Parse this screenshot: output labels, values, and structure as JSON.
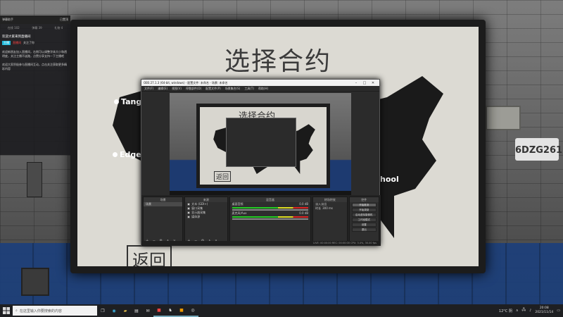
{
  "overlay": {
    "header_left": "弹幕助手",
    "header_right": "已置顶",
    "stats": [
      "在线 102",
      "弹幕 39",
      "礼物 4"
    ],
    "title": "欢迎大家来到直播间",
    "tag1": "主播",
    "tag2": "直播间",
    "tag3": "关注了你",
    "para1": "欢迎新朋友加入直播间，右侧可以调整字体大小和透明度，关注主播不迷路，点赞分享支持一下主播吧",
    "para2": "欢迎大家积极参与直播间互动，点击关注获取更多精彩内容"
  },
  "scene": {
    "board_title": "选择合约",
    "city_left_top": "Tang",
    "city_left_mid": "Edgefie",
    "city_right": "hool",
    "return_label": "返回",
    "plate": "6DZG261"
  },
  "obs": {
    "window_title": "OBS 27.1.3 (64-bit, windows) - 配置文件: 未命名 - 场景: 未命名",
    "menu": [
      "文件(F)",
      "编辑(E)",
      "视图(V)",
      "停靠部件(D)",
      "配置文件(P)",
      "场景集合(S)",
      "工具(T)",
      "帮助(H)"
    ],
    "preview_title": "选择合约",
    "preview_return": "返回",
    "docks": {
      "scenes": {
        "header": "场景",
        "items": [
          "场景"
        ]
      },
      "sources": {
        "header": "来源",
        "items": [
          "文本 (GDI+)",
          "窗口采集",
          "显示器采集",
          "媒体源"
        ]
      },
      "mixer": {
        "header": "混音器",
        "channels": [
          {
            "name": "桌面音频",
            "level": "0.0 dB"
          },
          {
            "name": "麦克风/Aux",
            "level": "0.0 dB"
          }
        ]
      },
      "transitions": {
        "header": "转场特效",
        "type": "淡入淡出",
        "duration_label": "时长",
        "duration": "300 ms"
      },
      "controls": {
        "header": "控件",
        "buttons": [
          "开始推流",
          "开始录制",
          "启动虚拟摄像机",
          "工作室模式",
          "设置",
          "退出"
        ]
      }
    },
    "status": "LIVE: 00:00:00  REC: 00:00:00  CPU: 3.4%, 30.00 fps"
  },
  "taskbar": {
    "search_placeholder": "在这里输入你要搜索的内容",
    "weather": "12°C  阴",
    "time": "20:08",
    "date": "2021/11/14"
  }
}
